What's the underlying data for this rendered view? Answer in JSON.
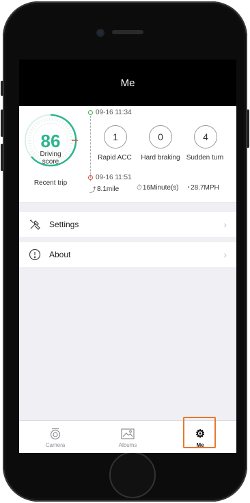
{
  "nav": {
    "title": "Me"
  },
  "summary": {
    "score": "86",
    "score_label_1": "Driving",
    "score_label_2": "score",
    "recent_label": "Recent trip",
    "start_time": "09-16 11:34",
    "end_time": "09-16 11:51",
    "counters": [
      {
        "value": "1",
        "label": "Rapid ACC"
      },
      {
        "value": "0",
        "label": "Hard braking"
      },
      {
        "value": "4",
        "label": "Sudden turn"
      }
    ],
    "distance": "8.1mile",
    "duration": "16Minute(s)",
    "speed": "28.7MPH",
    "gauge_level": 0.86
  },
  "menu": {
    "settings": {
      "label": "Settings",
      "icon": "tools-icon"
    },
    "about": {
      "label": "About",
      "icon": "info-icon"
    }
  },
  "tabs": [
    {
      "label": "Camera",
      "icon": "camera-icon"
    },
    {
      "label": "Albums",
      "icon": "image-icon"
    },
    {
      "label": "Me",
      "icon": "gear-icon"
    }
  ],
  "colors": {
    "accent": "#2fb48e",
    "highlight": "#e8782a",
    "start_dot": "#3db34a",
    "end_dot": "#e04a3a"
  }
}
